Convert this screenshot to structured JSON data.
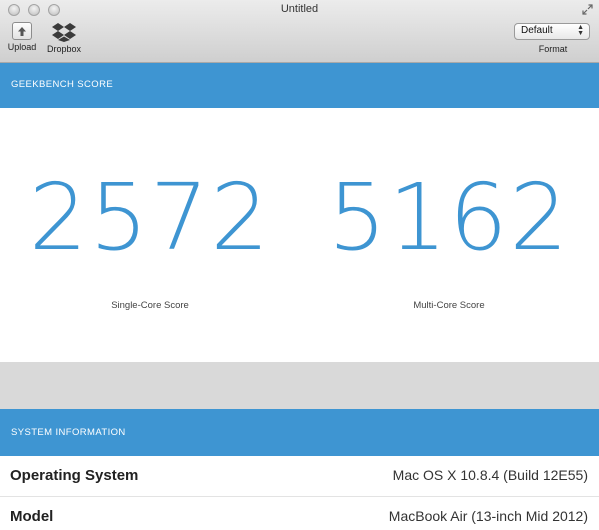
{
  "window": {
    "title": "Untitled"
  },
  "toolbar": {
    "upload_label": "Upload",
    "dropbox_label": "Dropbox",
    "format_value": "Default",
    "format_label": "Format"
  },
  "geekbench": {
    "header": "GEEKBENCH SCORE",
    "single_core": {
      "value": "2572",
      "label": "Single-Core Score"
    },
    "multi_core": {
      "value": "5162",
      "label": "Multi-Core Score"
    }
  },
  "system": {
    "header": "SYSTEM INFORMATION",
    "rows": [
      {
        "key": "Operating System",
        "value": "Mac OS X 10.8.4 (Build 12E55)"
      },
      {
        "key": "Model",
        "value": "MacBook Air (13-inch Mid 2012)"
      }
    ]
  },
  "colors": {
    "accent": "#3e95d2",
    "gap": "#d9d9d9"
  }
}
